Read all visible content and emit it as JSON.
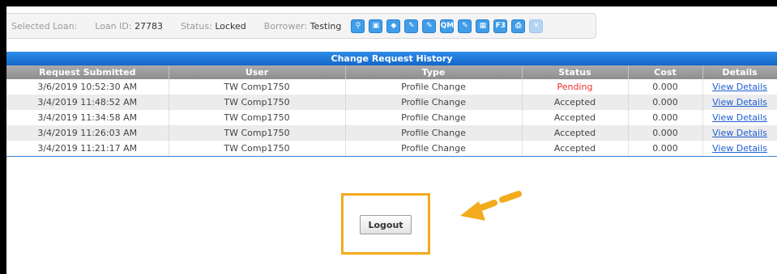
{
  "loan_bar": {
    "selected_loan_label": "Selected Loan:",
    "loan_id_label": "Loan ID:",
    "loan_id": "27783",
    "status_label": "Status:",
    "status": "Locked",
    "borrower_label": "Borrower:",
    "borrower": "Testing",
    "icons": [
      {
        "name": "search-icon",
        "glyph": "⚲"
      },
      {
        "name": "lock-icon",
        "glyph": "▣"
      },
      {
        "name": "tag-icon",
        "glyph": "◆"
      },
      {
        "name": "edit-icon",
        "glyph": "✎"
      },
      {
        "name": "edit-settings-icon",
        "glyph": "✎"
      },
      {
        "name": "qm-icon",
        "glyph": "QM"
      },
      {
        "name": "edit-gear-icon",
        "glyph": "✎"
      },
      {
        "name": "calculator-icon",
        "glyph": "▦"
      },
      {
        "name": "f32-icon",
        "glyph": "F3"
      },
      {
        "name": "print-icon",
        "glyph": "⎙"
      },
      {
        "name": "disabled-delete-icon",
        "glyph": "✕",
        "disabled": true
      }
    ]
  },
  "grid": {
    "title": "Change Request History",
    "columns": [
      "Request Submitted",
      "User",
      "Type",
      "Status",
      "Cost",
      "Details"
    ],
    "rows": [
      {
        "submitted": "3/6/2019 10:52:30 AM",
        "user": "TW Comp1750",
        "type": "Profile Change",
        "status": "Pending",
        "cost": "0.000",
        "details": "View Details"
      },
      {
        "submitted": "3/4/2019 11:48:52 AM",
        "user": "TW Comp1750",
        "type": "Profile Change",
        "status": "Accepted",
        "cost": "0.000",
        "details": "View Details"
      },
      {
        "submitted": "3/4/2019 11:34:58 AM",
        "user": "TW Comp1750",
        "type": "Profile Change",
        "status": "Accepted",
        "cost": "0.000",
        "details": "View Details"
      },
      {
        "submitted": "3/4/2019 11:26:03 AM",
        "user": "TW Comp1750",
        "type": "Profile Change",
        "status": "Accepted",
        "cost": "0.000",
        "details": "View Details"
      },
      {
        "submitted": "3/4/2019 11:21:17 AM",
        "user": "TW Comp1750",
        "type": "Profile Change",
        "status": "Accepted",
        "cost": "0.000",
        "details": "View Details"
      }
    ]
  },
  "logout_label": "Logout",
  "colors": {
    "header_blue": "#1466c8",
    "pending_red": "#e8302a",
    "link_blue": "#1f5fd6",
    "highlight_orange": "#f2ab1d"
  }
}
